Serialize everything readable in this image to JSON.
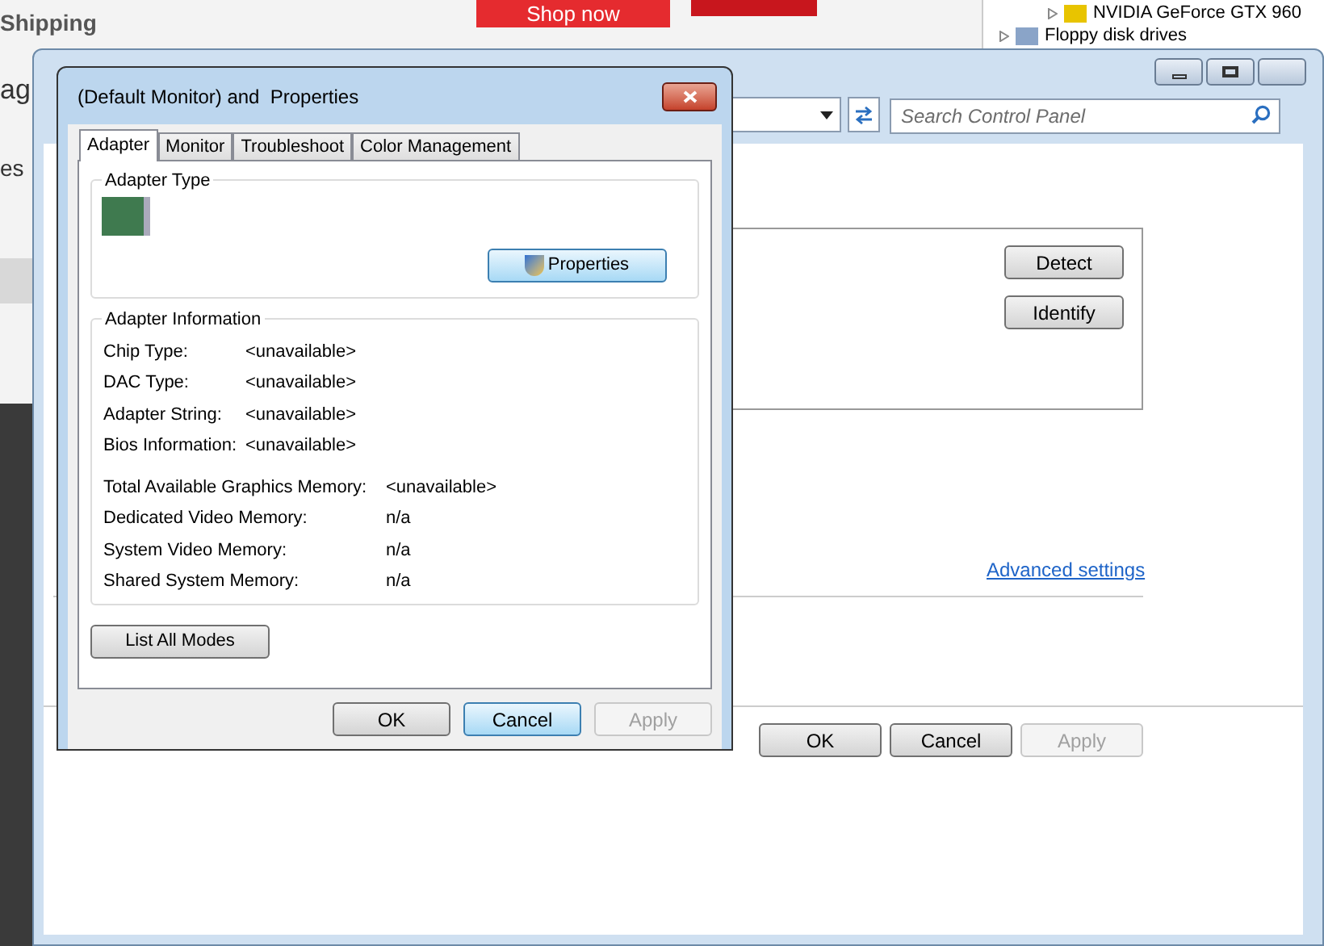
{
  "background_page": {
    "heading": "Shipping",
    "banner": "Shop now",
    "fragment_1": "ag",
    "fragment_2": "es"
  },
  "device_manager": {
    "items": [
      {
        "label": "NVIDIA GeForce GTX 960",
        "expanded": false,
        "kind": "device"
      },
      {
        "label": "Floppy disk drives",
        "expanded": false,
        "kind": "category"
      }
    ]
  },
  "main_window": {
    "search": {
      "placeholder": "Search Control Panel"
    },
    "buttons": [
      {
        "label": "Detect",
        "disabled": false
      },
      {
        "label": "Identify",
        "disabled": false
      }
    ],
    "link": "Advanced settings",
    "footer_buttons": [
      {
        "label": "OK",
        "disabled": false
      },
      {
        "label": "Cancel",
        "disabled": false
      },
      {
        "label": "Apply",
        "disabled": true
      }
    ]
  },
  "dialog": {
    "title": "(Default Monitor) and  Properties",
    "tabs": [
      {
        "label": "Adapter",
        "selected": true
      },
      {
        "label": "Monitor",
        "selected": false
      },
      {
        "label": "Troubleshoot",
        "selected": false
      },
      {
        "label": "Color Management",
        "selected": false
      }
    ],
    "adapter_type": {
      "heading": "Adapter Type",
      "button": "Properties"
    },
    "adapter_information": {
      "heading": "Adapter Information",
      "rows": [
        {
          "label": "Chip Type:",
          "value": "<unavailable>"
        },
        {
          "label": "DAC Type:",
          "value": "<unavailable>"
        },
        {
          "label": "Adapter String:",
          "value": "<unavailable>"
        },
        {
          "label": "Bios Information:",
          "value": "<unavailable>"
        }
      ],
      "memory_rows": [
        {
          "label": "Total Available Graphics Memory:",
          "value": "<unavailable>"
        },
        {
          "label": "Dedicated Video Memory:",
          "value": "n/a"
        },
        {
          "label": "System Video Memory:",
          "value": "n/a"
        },
        {
          "label": "Shared System Memory:",
          "value": "n/a"
        }
      ]
    },
    "list_button": "List All Modes",
    "footer_buttons": [
      {
        "label": "OK",
        "disabled": false,
        "focused": false
      },
      {
        "label": "Cancel",
        "disabled": false,
        "focused": true
      },
      {
        "label": "Apply",
        "disabled": true,
        "focused": false
      }
    ]
  }
}
